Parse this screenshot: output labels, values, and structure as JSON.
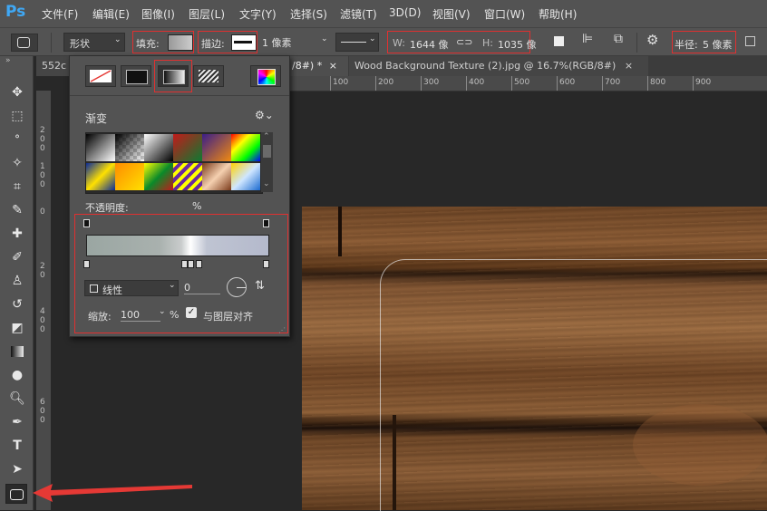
{
  "app": {
    "logo": "Ps"
  },
  "menu": [
    "文件(F)",
    "编辑(E)",
    "图像(I)",
    "图层(L)",
    "文字(Y)",
    "选择(S)",
    "滤镜(T)",
    "3D(D)",
    "视图(V)",
    "窗口(W)",
    "帮助(H)"
  ],
  "options": {
    "mode": "形状",
    "fill_label": "填充:",
    "stroke_label": "描边:",
    "stroke_width": "1 像素",
    "w_label": "W:",
    "w_value": "1644 像",
    "h_label": "H:",
    "h_value": "1035 像",
    "radius_label": "半径:",
    "radius_value": "5 像素"
  },
  "tabs": [
    {
      "label": "552c"
    },
    {
      "label": "/8#) *",
      "close": "×"
    },
    {
      "label": "Wood Background Texture (2).jpg @ 16.7%(RGB/8#)",
      "close": "×"
    }
  ],
  "ruler_h": [
    "100",
    "200",
    "300",
    "400",
    "500",
    "600",
    "700",
    "800",
    "900"
  ],
  "ruler_v": [
    "2",
    "0",
    "0",
    "1",
    "0",
    "0",
    "0",
    "2",
    "0",
    "4",
    "0",
    "0",
    "6",
    "0",
    "0"
  ],
  "panel": {
    "section_title": "渐变",
    "opacity_label": "不透明度:",
    "opacity_unit": "%",
    "style_value": "线性",
    "angle_value": "0",
    "scale_label": "缩放:",
    "scale_value": "100",
    "scale_unit": "%",
    "align_label": "与图层对齐",
    "align_checked": true
  },
  "colors": {
    "highlight": "#e03030",
    "arrow": "#e53935"
  }
}
